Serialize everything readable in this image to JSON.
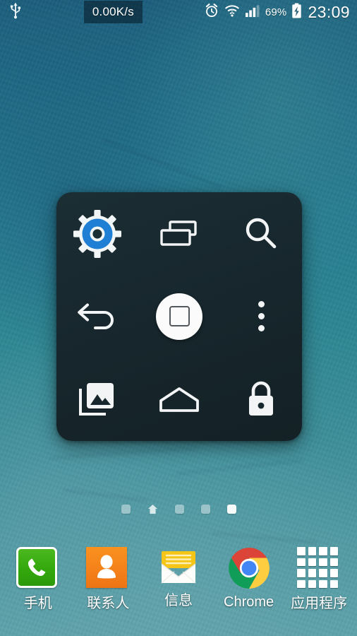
{
  "statusbar": {
    "usb_icon": "usb-icon",
    "network_speed": "0.00K/s",
    "alarm_icon": "alarm-clock-icon",
    "wifi_icon": "wifi-icon",
    "signal_icon": "cellular-signal-icon",
    "battery_percent": "69%",
    "battery_icon": "battery-charging-icon",
    "clock": "23:09"
  },
  "control_panel": {
    "items": [
      {
        "name": "settings",
        "icon": "settings-gear-icon",
        "label": "Settings"
      },
      {
        "name": "recents",
        "icon": "recent-apps-icon",
        "label": "Recent apps"
      },
      {
        "name": "search",
        "icon": "search-icon",
        "label": "Search"
      },
      {
        "name": "back",
        "icon": "back-arrow-icon",
        "label": "Back"
      },
      {
        "name": "home",
        "icon": "home-circle-icon",
        "label": "Home"
      },
      {
        "name": "more",
        "icon": "overflow-menu-icon",
        "label": "More"
      },
      {
        "name": "gallery",
        "icon": "gallery-images-icon",
        "label": "Gallery"
      },
      {
        "name": "homepage",
        "icon": "house-outline-icon",
        "label": "Home screen"
      },
      {
        "name": "lock",
        "icon": "lock-icon",
        "label": "Lock screen"
      }
    ],
    "accent_color": "#1e7fd4",
    "panel_color": "#17272d"
  },
  "page_indicator": {
    "count": 5,
    "active_index": 4,
    "home_index": 1,
    "dots": [
      {
        "state": "dim"
      },
      {
        "state": "home"
      },
      {
        "state": "dim"
      },
      {
        "state": "dim"
      },
      {
        "state": "active"
      }
    ]
  },
  "dock": {
    "items": [
      {
        "name": "phone",
        "label": "手机",
        "icon": "phone-icon",
        "color": "#35a80d"
      },
      {
        "name": "contacts",
        "label": "联系人",
        "icon": "contacts-icon",
        "color": "#f4801a"
      },
      {
        "name": "messages",
        "label": "信息",
        "icon": "messaging-icon",
        "color": "#f5c518"
      },
      {
        "name": "chrome",
        "label": "Chrome",
        "icon": "chrome-icon",
        "color": "#4285f4"
      },
      {
        "name": "appdrawer",
        "label": "应用程序",
        "icon": "app-drawer-icon",
        "color": "#ffffff"
      }
    ]
  }
}
